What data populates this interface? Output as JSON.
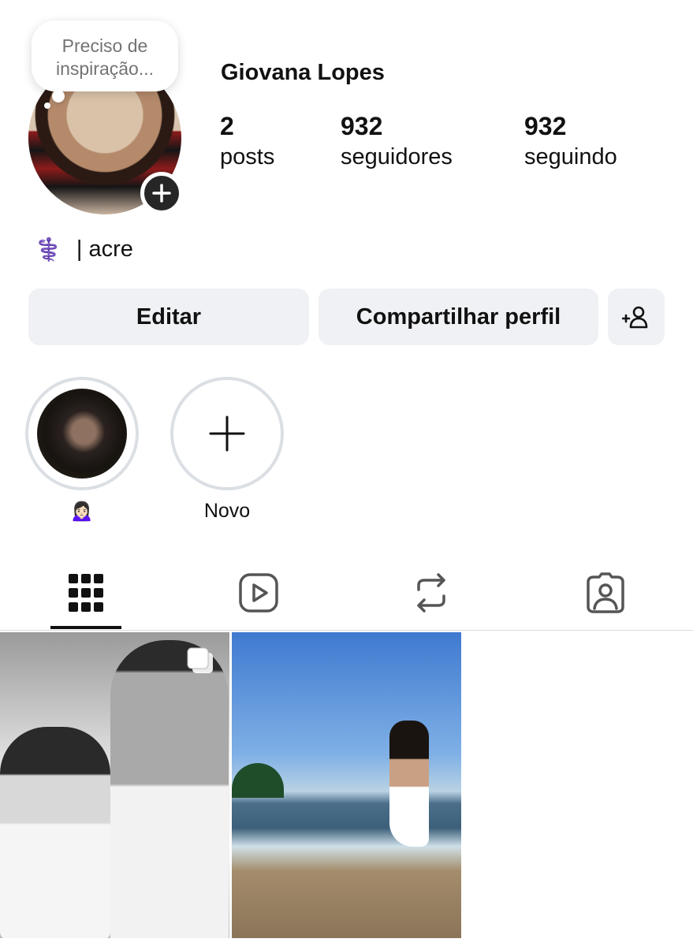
{
  "profile": {
    "note": "Preciso de inspiração...",
    "name": "Giovana Lopes",
    "stats": [
      {
        "value": "2",
        "label": "posts"
      },
      {
        "value": "932",
        "label": "seguidores"
      },
      {
        "value": "932",
        "label": "seguindo"
      }
    ],
    "bio_icon": "⚕️",
    "bio_text": "| acre"
  },
  "buttons": {
    "edit_label": "Editar",
    "share_label": "Compartilhar perfil",
    "add_person_icon": "add-person-icon"
  },
  "highlights": [
    {
      "label": "🙍🏻‍♀️"
    },
    {
      "label": "Novo"
    }
  ],
  "tabs": [
    {
      "icon": "grid-icon",
      "active": true
    },
    {
      "icon": "reels-icon",
      "active": false
    },
    {
      "icon": "reposts-icon",
      "active": false
    },
    {
      "icon": "tagged-icon",
      "active": false
    }
  ],
  "colors": {
    "button_bg": "#eff1f4",
    "badge_bg": "#262626",
    "ring": "#dbdfe4",
    "text": "#111111",
    "muted": "#737373"
  }
}
